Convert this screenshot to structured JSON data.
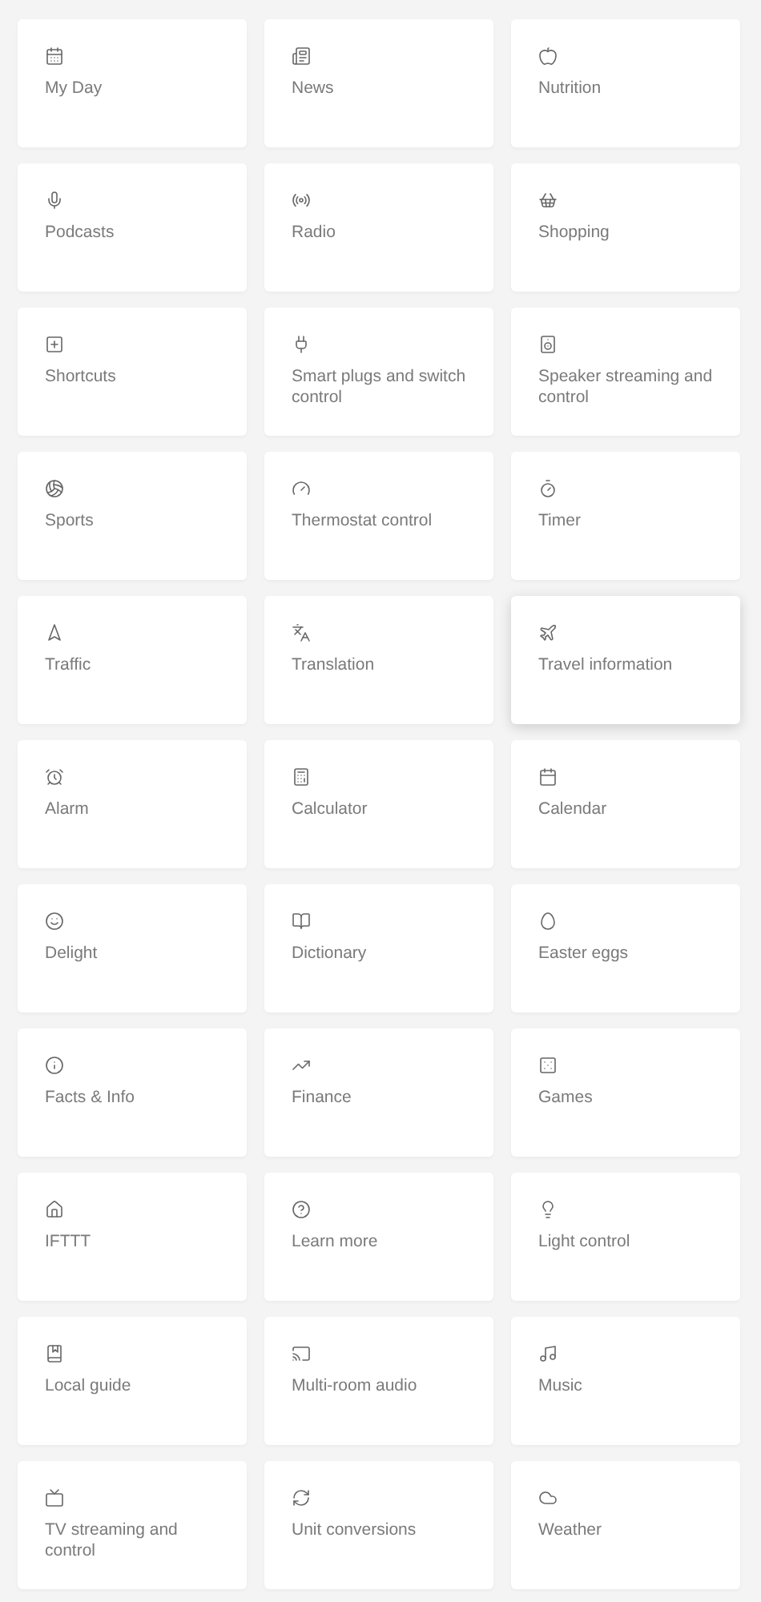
{
  "cards": [
    {
      "label": "My Day",
      "hovered": false
    },
    {
      "label": "News",
      "hovered": false
    },
    {
      "label": "Nutrition",
      "hovered": false
    },
    {
      "label": "Podcasts",
      "hovered": false
    },
    {
      "label": "Radio",
      "hovered": false
    },
    {
      "label": "Shopping",
      "hovered": false
    },
    {
      "label": "Shortcuts",
      "hovered": false
    },
    {
      "label": "Smart plugs and switch control",
      "hovered": false
    },
    {
      "label": "Speaker streaming and control",
      "hovered": false
    },
    {
      "label": "Sports",
      "hovered": false
    },
    {
      "label": "Thermostat control",
      "hovered": false
    },
    {
      "label": "Timer",
      "hovered": false
    },
    {
      "label": "Traffic",
      "hovered": false
    },
    {
      "label": "Translation",
      "hovered": false
    },
    {
      "label": "Travel information",
      "hovered": true
    },
    {
      "label": "Alarm",
      "hovered": false
    },
    {
      "label": "Calculator",
      "hovered": false
    },
    {
      "label": "Calendar",
      "hovered": false
    },
    {
      "label": "Delight",
      "hovered": false
    },
    {
      "label": "Dictionary",
      "hovered": false
    },
    {
      "label": "Easter eggs",
      "hovered": false
    },
    {
      "label": "Facts & Info",
      "hovered": false
    },
    {
      "label": "Finance",
      "hovered": false
    },
    {
      "label": "Games",
      "hovered": false
    },
    {
      "label": "IFTTT",
      "hovered": false
    },
    {
      "label": "Learn more",
      "hovered": false
    },
    {
      "label": "Light control",
      "hovered": false
    },
    {
      "label": "Local guide",
      "hovered": false
    },
    {
      "label": "Multi-room audio",
      "hovered": false
    },
    {
      "label": "Music",
      "hovered": false
    },
    {
      "label": "TV streaming and control",
      "hovered": false
    },
    {
      "label": "Unit conversions",
      "hovered": false
    },
    {
      "label": "Weather",
      "hovered": false
    }
  ]
}
